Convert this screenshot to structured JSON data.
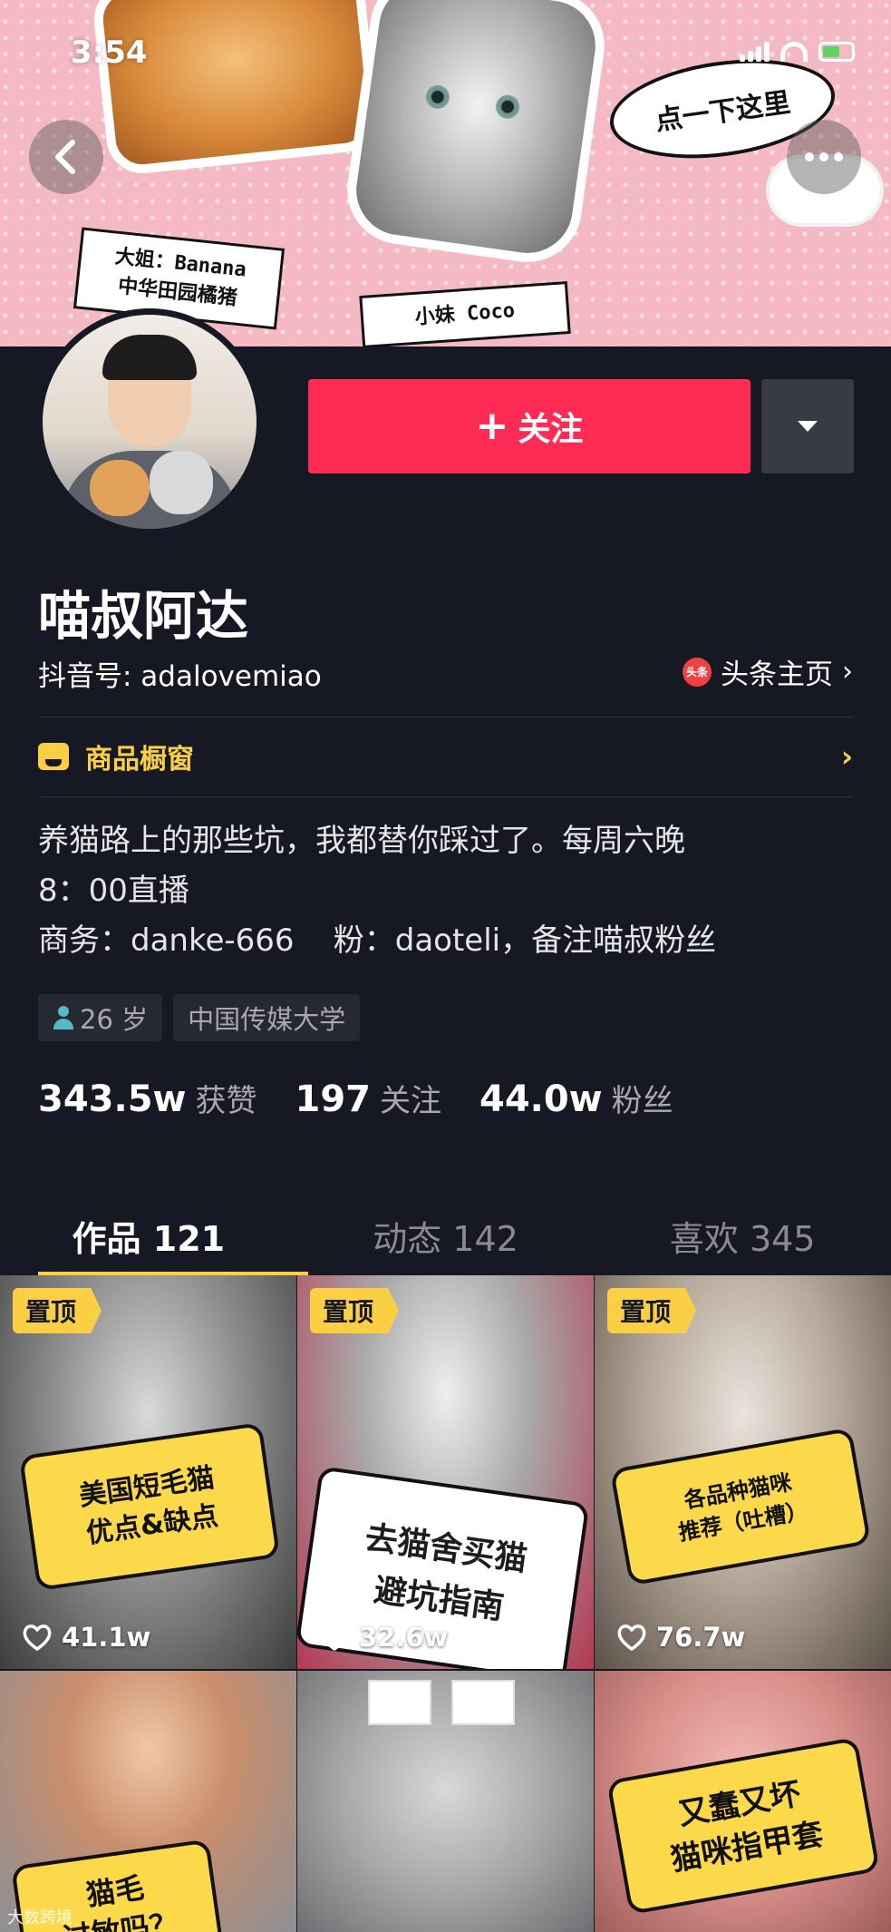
{
  "status_bar": {
    "time": "3:54"
  },
  "cover": {
    "sign_1_line1": "大姐：Banana",
    "sign_1_line2": "中华田园橘猪",
    "sign_2_line1": "小妹 Coco",
    "bubble_text": "点一下这里"
  },
  "header": {
    "back_icon": "back-arrow-icon",
    "more_icon": "more-dots-icon"
  },
  "profile": {
    "follow_label": "关注",
    "follow_prefix": "+",
    "nickname": "喵叔阿达",
    "douyin_id": "抖音号: adalovemiao",
    "toutiao_badge": "头条",
    "toutiao_label": "头条主页",
    "shop_label": "商品橱窗",
    "bio_lines": [
      "养猫路上的那些坑，我都替你踩过了。每周六晚",
      "8：00直播",
      "商务：danke-666    粉：daoteli，备注喵叔粉丝"
    ],
    "tags": {
      "age": "26 岁",
      "school": "中国传媒大学"
    },
    "stats": [
      {
        "value": "343.5w",
        "label": "获赞"
      },
      {
        "value": "197",
        "label": "关注"
      },
      {
        "value": "44.0w",
        "label": "粉丝"
      }
    ]
  },
  "tabs": [
    {
      "label": "作品 121",
      "active": true
    },
    {
      "label": "动态 142",
      "active": false
    },
    {
      "label": "喜欢 345",
      "active": false
    }
  ],
  "videos": [
    {
      "pinned": "置顶",
      "caption_1": "美国短毛猫",
      "caption_2": "优点&缺点",
      "likes": "41.1w"
    },
    {
      "pinned": "置顶",
      "caption_1": "去猫舍买猫",
      "caption_2": "避坑指南",
      "likes": "32.6w"
    },
    {
      "pinned": "置顶",
      "caption_1": "各品种猫咪",
      "caption_2": "推荐（吐槽）",
      "likes": "76.7w"
    },
    {
      "caption_1": "猫毛",
      "caption_2": "过敏吗？"
    },
    {},
    {
      "caption_1": "又蠢又坏",
      "caption_2": "猫咪指甲套"
    }
  ],
  "watermark": "大数跨境",
  "colors": {
    "background": "#161823",
    "accent_red": "#fe2c55",
    "accent_yellow": "#facf44"
  }
}
